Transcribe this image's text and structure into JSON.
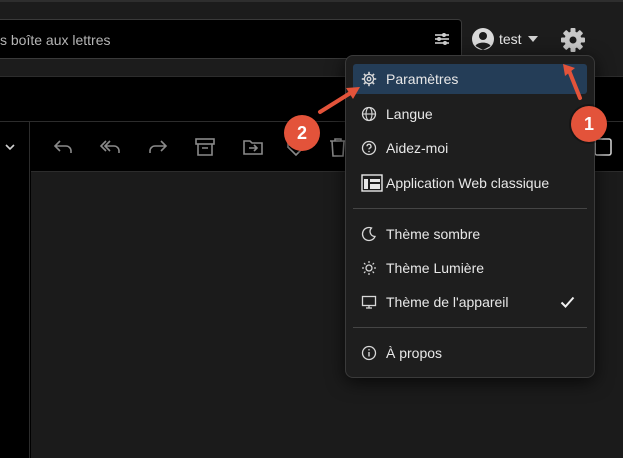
{
  "search": {
    "placeholder": "s boîte aux lettres"
  },
  "account": {
    "username": "test"
  },
  "menu": {
    "items": [
      {
        "label": "Paramètres",
        "icon": "gear-icon",
        "active": true
      },
      {
        "label": "Langue",
        "icon": "globe-icon"
      },
      {
        "label": "Aidez-moi",
        "icon": "help-circle-icon"
      },
      {
        "label": "Application Web classique",
        "icon": "classic-app-icon"
      }
    ],
    "themes": [
      {
        "label": "Thème sombre",
        "icon": "moon-icon"
      },
      {
        "label": "Thème Lumière",
        "icon": "sun-icon"
      },
      {
        "label": "Thème de l'appareil",
        "icon": "monitor-icon",
        "checked": true
      }
    ],
    "about": {
      "label": "À propos",
      "icon": "info-icon"
    }
  },
  "annotations": {
    "step1": "1",
    "step2": "2"
  },
  "colors": {
    "accent_annotation": "#e3533a",
    "active_item": "#243d57",
    "menu_bg": "#1e1e1e"
  }
}
